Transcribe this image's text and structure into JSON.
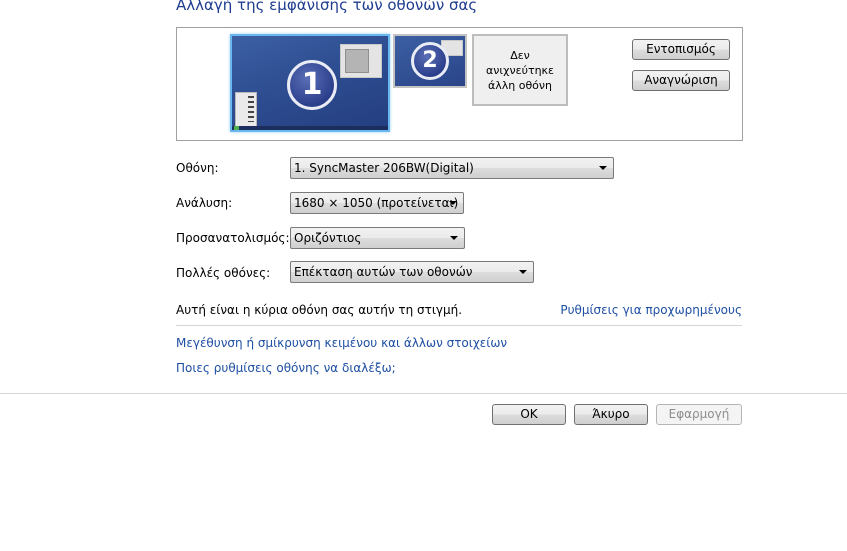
{
  "title": "Αλλαγή της εμφάνισης των οθονών σας",
  "preview": {
    "monitor1_number": "1",
    "monitor2_number": "2",
    "monitor3_label": "Δεν ανιχνεύτηκε άλλη οθόνη"
  },
  "buttons": {
    "identify": "Εντοπισμός",
    "detect": "Αναγνώριση",
    "ok": "OK",
    "cancel": "Άκυρο",
    "apply": "Εφαρμογή"
  },
  "form": {
    "display": {
      "label": "Οθόνη:",
      "value": "1. SyncMaster 206BW(Digital)"
    },
    "resolution": {
      "label": "Ανάλυση:",
      "value": "1680 × 1050 (προτείνεται)"
    },
    "orientation": {
      "label": "Προσανατολισμός:",
      "value": "Οριζόντιος"
    },
    "multiple": {
      "label": "Πολλές οθόνες:",
      "value": "Επέκταση αυτών των οθονών"
    }
  },
  "status_text": "Αυτή είναι η κύρια οθόνη σας αυτήν τη στιγμή.",
  "links": {
    "advanced": "Ρυθμίσεις για προχωρημένους",
    "text_size": "Μεγέθυνση ή σμίκρυνση κειμένου και άλλων στοιχείων",
    "which_settings": "Ποιες ρυθμίσεις οθόνης να διαλέξω;"
  }
}
